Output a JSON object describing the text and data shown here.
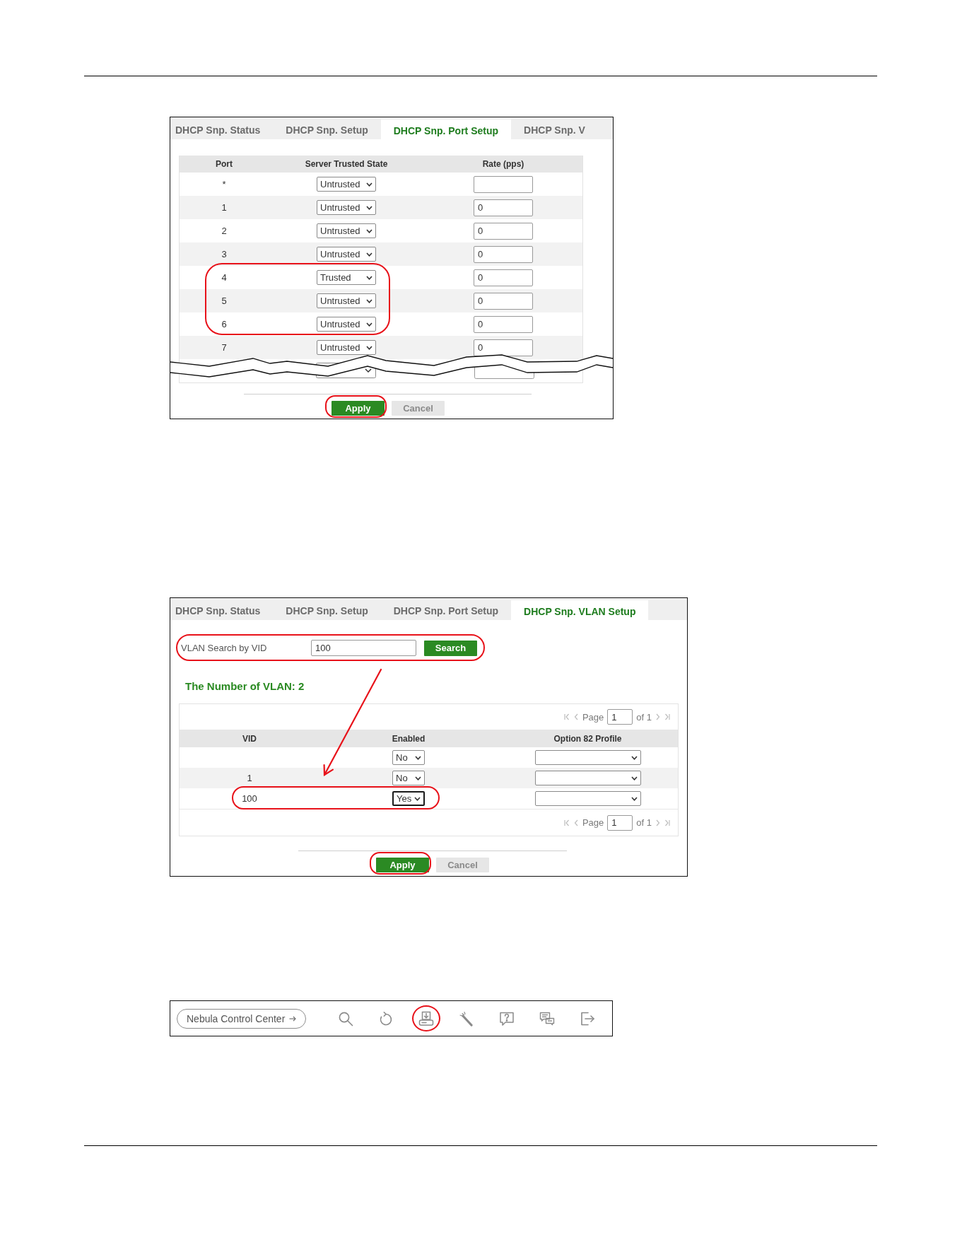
{
  "port_setup_panel": {
    "tabs": [
      {
        "label": "DHCP Snp. Status",
        "selected": false
      },
      {
        "label": "DHCP Snp. Setup",
        "selected": false
      },
      {
        "label": "DHCP Snp. Port Setup",
        "selected": true
      },
      {
        "label": "DHCP Snp. V",
        "selected": false
      }
    ],
    "table": {
      "columns": [
        "Port",
        "Server Trusted State",
        "Rate (pps)"
      ],
      "rows": [
        {
          "kind": "row",
          "port": "*",
          "state": "Untrusted",
          "circled": false
        },
        {
          "kind": "row",
          "port": "1",
          "state": "Untrusted",
          "rate": "0",
          "circled": false
        },
        {
          "kind": "row",
          "port": "2",
          "state": "Untrusted",
          "rate": "0",
          "circled": false
        },
        {
          "kind": "row",
          "port": "3",
          "state": "Untrusted",
          "rate": "0",
          "circled": false
        },
        {
          "kind": "row",
          "port": "4",
          "state": "Trusted",
          "rate": "0",
          "circled": true
        },
        {
          "kind": "row",
          "port": "5",
          "state": "Untrusted",
          "rate": "0",
          "circled": true
        },
        {
          "kind": "row",
          "port": "6",
          "state": "Untrusted",
          "rate": "0",
          "circled": true
        },
        {
          "kind": "row",
          "port": "7",
          "state": "Untrusted",
          "rate": "0",
          "circled": false
        },
        {
          "kind": "torn"
        }
      ]
    },
    "buttons": [
      {
        "label": "Apply",
        "kind": "primary",
        "circled": true
      },
      {
        "label": "Cancel",
        "kind": "secondary",
        "circled": false
      }
    ]
  },
  "vlan_setup_panel": {
    "tabs": [
      {
        "label": "DHCP Snp. Status",
        "selected": false
      },
      {
        "label": "DHCP Snp. Setup",
        "selected": false
      },
      {
        "label": "DHCP Snp. Port Setup",
        "selected": false
      },
      {
        "label": "DHCP Snp. VLAN Setup",
        "selected": true
      }
    ],
    "search": {
      "label": "VLAN Search by VID",
      "value": "100",
      "button": "Search",
      "circled": true
    },
    "count_label": "The Number of VLAN: 2",
    "pagination_top": {
      "label": "Page",
      "page": "1",
      "total": "of 1"
    },
    "table": {
      "columns": [
        "VID",
        "Enabled",
        "Option 82 Profile"
      ],
      "rows": [
        {
          "enabled": "No",
          "focused": false,
          "circled": false
        },
        {
          "vid": "1",
          "enabled": "No",
          "focused": false,
          "circled": false
        },
        {
          "vid": "100",
          "enabled": "Yes",
          "focused": true,
          "circled": true
        }
      ]
    },
    "pagination_bottom": {
      "label": "Page",
      "page": "1",
      "total": "of 1"
    },
    "buttons": [
      {
        "label": "Apply",
        "kind": "primary",
        "circled": true
      },
      {
        "label": "Cancel",
        "kind": "secondary",
        "circled": false
      }
    ]
  },
  "toolbar": {
    "link": "Nebula Control Center",
    "tools": [
      {
        "kind": "search",
        "circled": false
      },
      {
        "kind": "refresh",
        "circled": false
      },
      {
        "kind": "save",
        "circled": true
      },
      {
        "kind": "wand",
        "circled": false
      },
      {
        "kind": "help",
        "circled": false
      },
      {
        "kind": "chat",
        "circled": false
      },
      {
        "kind": "logout",
        "circled": false
      }
    ]
  }
}
